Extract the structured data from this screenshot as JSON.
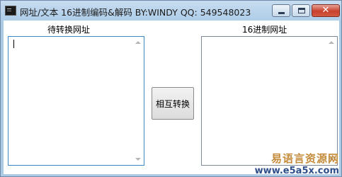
{
  "window": {
    "title": "网址/文本 16进制编码&解码  BY:WINDY QQ:  549548023"
  },
  "labels": {
    "left": "待转换网址",
    "right": "16进制网址"
  },
  "inputs": {
    "left_value": "",
    "right_value": ""
  },
  "button": {
    "convert_label": "相互转换"
  },
  "watermark": {
    "cn": "易语言资源网",
    "url": "www.e5a5x.com"
  },
  "colors": {
    "title_bg": "#abcbe4",
    "close_button": "#c7412c",
    "focus_border": "#3b86c7",
    "watermark_cn": "#c48b3b",
    "watermark_url": "#2e4f8a"
  }
}
